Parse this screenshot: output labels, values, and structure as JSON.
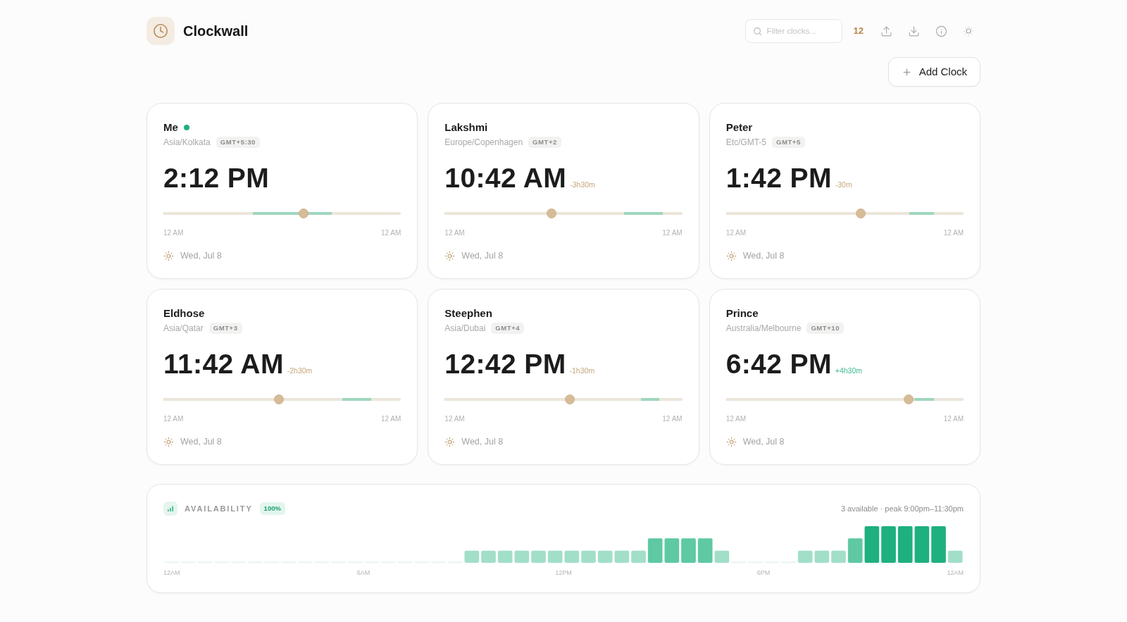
{
  "app": {
    "title": "Clockwall"
  },
  "toolbar": {
    "search": {
      "placeholder": "Filter clocks..."
    },
    "clock_count": "12"
  },
  "add_button": {
    "label": "Add Clock"
  },
  "clocks": [
    {
      "name": "Me",
      "current": true,
      "timezone": "Asia/Kolkata",
      "gmt": "GMT+5:30",
      "time": "2:12 PM",
      "slider": {
        "level": 0.589,
        "work_hours": {
          "from": {
            "level": 0.376
          },
          "to": {
            "level": 0.709
          }
        }
      },
      "range_start": "12 AM",
      "range_end": "12 AM",
      "daytime": true,
      "date": "Wed, Jul 8"
    },
    {
      "name": "Lakshmi",
      "current": false,
      "timezone": "Europe/Copenhagen",
      "gmt": "GMT+2",
      "time": "10:42 AM",
      "offset": {
        "text": "-3h30m",
        "kind": "behind"
      },
      "slider": {
        "level": 0.449,
        "work_hours": {
          "from": {
            "level": 0.754
          },
          "to": {
            "level": 0.919
          }
        }
      },
      "range_start": "12 AM",
      "range_end": "12 AM",
      "daytime": true,
      "date": "Wed, Jul 8"
    },
    {
      "name": "Peter",
      "current": false,
      "timezone": "Etc/GMT-5",
      "gmt": "GMT+5",
      "time": "1:42 PM",
      "offset": {
        "text": "-30m",
        "kind": "behind"
      },
      "slider": {
        "level": 0.568,
        "work_hours": {
          "from": {
            "level": 0.773
          },
          "to": {
            "level": 0.875
          }
        }
      },
      "range_start": "12 AM",
      "range_end": "12 AM",
      "daytime": true,
      "date": "Wed, Jul 8"
    },
    {
      "name": "Eldhose",
      "current": false,
      "timezone": "Asia/Qatar",
      "gmt": "GMT+3",
      "time": "11:42 AM",
      "offset": {
        "text": "-2h30m",
        "kind": "behind"
      },
      "slider": {
        "level": 0.485,
        "work_hours": {
          "from": {
            "level": 0.753
          },
          "to": {
            "level": 0.876
          }
        }
      },
      "range_start": "12 AM",
      "range_end": "12 AM",
      "daytime": true,
      "date": "Wed, Jul 8"
    },
    {
      "name": "Steephen",
      "current": false,
      "timezone": "Asia/Dubai",
      "gmt": "GMT+4",
      "time": "12:42 PM",
      "offset": {
        "text": "-1h30m",
        "kind": "behind"
      },
      "slider": {
        "level": 0.528,
        "work_hours": {
          "from": {
            "level": 0.825
          },
          "to": {
            "level": 0.903
          }
        }
      },
      "range_start": "12 AM",
      "range_end": "12 AM",
      "daytime": true,
      "date": "Wed, Jul 8"
    },
    {
      "name": "Prince",
      "current": false,
      "timezone": "Australia/Melbourne",
      "gmt": "GMT+10",
      "time": "6:42 PM",
      "offset": {
        "text": "+4h30m",
        "kind": "ahead"
      },
      "slider": {
        "level": 0.768,
        "work_hours": {
          "from": {
            "level": 0.793
          },
          "to": {
            "level": 0.876
          }
        }
      },
      "range_start": "12 AM",
      "range_end": "12 AM",
      "daytime": true,
      "date": "Wed, Jul 8"
    }
  ],
  "availability": {
    "title": "AVAILABILITY",
    "score": "100%",
    "summary": "3 available · peak 9:00pm–11:30pm",
    "axis_labels": [
      "12AM",
      "6AM",
      "12PM",
      "6PM",
      "12AM"
    ]
  }
}
